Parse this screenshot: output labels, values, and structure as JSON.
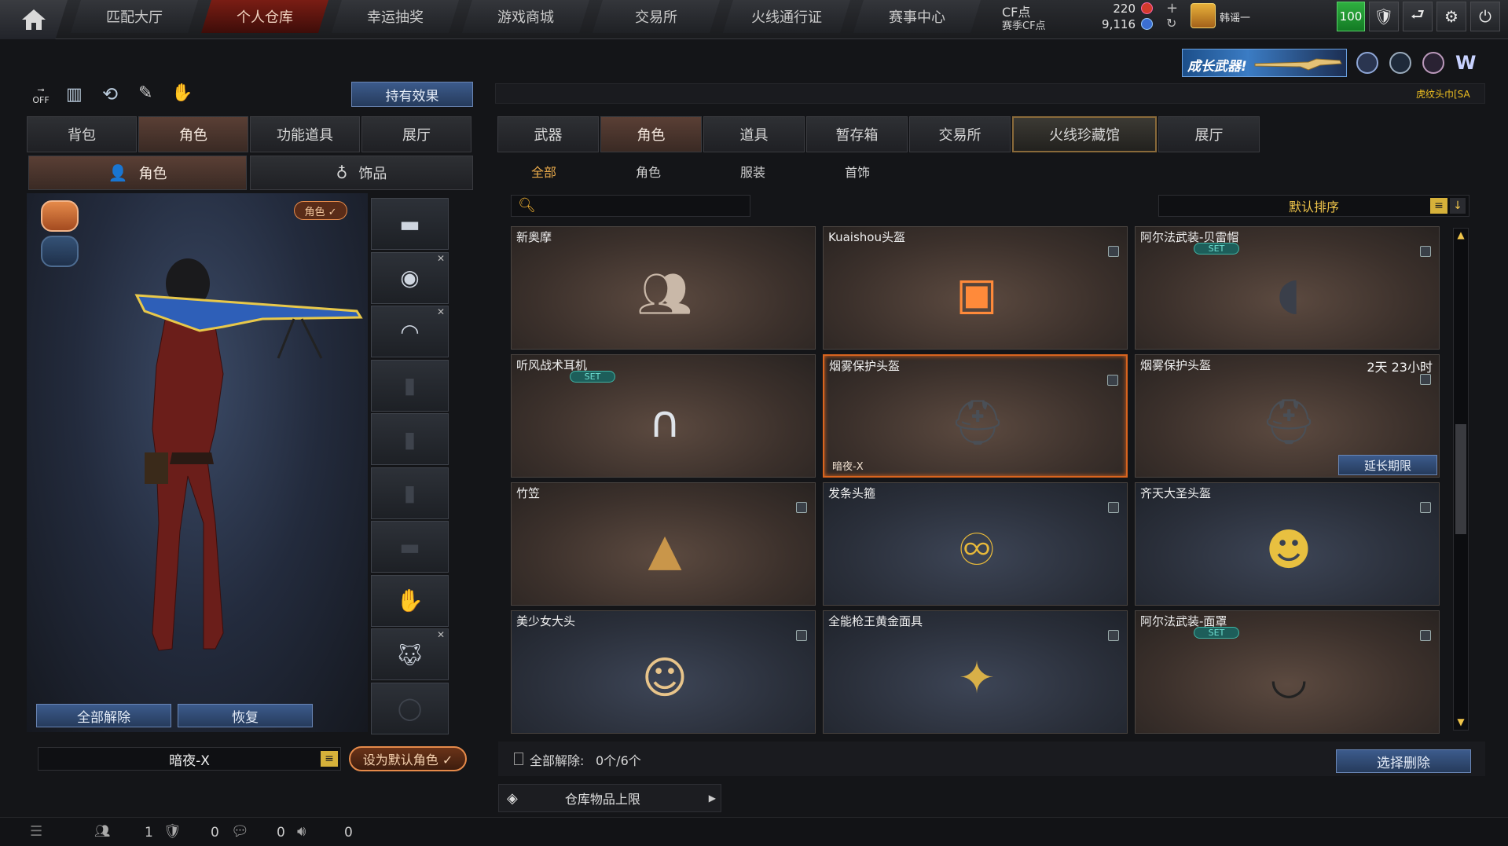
{
  "top_nav": {
    "tabs": [
      "匹配大厅",
      "个人仓库",
      "幸运抽奖",
      "游戏商城",
      "交易所",
      "火线通行证",
      "赛事中心"
    ],
    "active_index": 1,
    "cf_point_label": "CF点",
    "cf_point_value": "220",
    "season_cf_label": "赛季CF点",
    "season_cf_value": "9,116",
    "username": "韩谣一",
    "level_badge": "100"
  },
  "banner": {
    "promo_text": "成长武器!",
    "scroll_text": "虎纹头巾[SA"
  },
  "left": {
    "hold_effect_button": "持有效果",
    "main_tabs": [
      "背包",
      "角色",
      "功能道具",
      "展厅"
    ],
    "main_active": 1,
    "sub_tabs": [
      "角色",
      "饰品"
    ],
    "sub_active": 0,
    "role_badge": "角色 ✓",
    "unequip_all_button": "全部解除",
    "restore_button": "恢复",
    "character_name": "暗夜-X",
    "set_default_button": "设为默认角色 ✓"
  },
  "right": {
    "category_tabs": [
      "武器",
      "角色",
      "道具",
      "暂存箱",
      "交易所",
      "火线珍藏馆",
      "展厅"
    ],
    "category_active": 1,
    "highlight_tab": 5,
    "filter_tabs": [
      "全部",
      "角色",
      "服装",
      "首饰"
    ],
    "filter_active": 0,
    "search_placeholder": "",
    "sort_label": "默认排序",
    "items": [
      {
        "name": "新奥摩",
        "set": false,
        "tint": "brown",
        "note": ""
      },
      {
        "name": "Kuaishou头盔",
        "set": false,
        "tint": "brown",
        "note": ""
      },
      {
        "name": "阿尔法武装-贝雷帽",
        "set": true,
        "tint": "brown",
        "note": ""
      },
      {
        "name": "听风战术耳机",
        "set": true,
        "tint": "brown",
        "note": ""
      },
      {
        "name": "烟雾保护头盔",
        "set": false,
        "tint": "brown",
        "note": "暗夜-X",
        "selected": true
      },
      {
        "name": "烟雾保护头盔",
        "set": false,
        "tint": "brown",
        "note": "",
        "timer": "2天 23小时",
        "extend": "延长期限"
      },
      {
        "name": "竹笠",
        "set": false,
        "tint": "brown",
        "note": ""
      },
      {
        "name": "发条头箍",
        "set": false,
        "tint": "blue",
        "note": ""
      },
      {
        "name": "齐天大圣头盔",
        "set": false,
        "tint": "blue",
        "note": ""
      },
      {
        "name": "美少女大头",
        "set": false,
        "tint": "blue",
        "note": ""
      },
      {
        "name": "全能枪王黄金面具",
        "set": false,
        "tint": "blue",
        "note": ""
      },
      {
        "name": "阿尔法武装-面罩",
        "set": true,
        "tint": "brown",
        "note": ""
      }
    ],
    "set_label": "SET",
    "unequip_count_label": "全部解除:",
    "unequip_count_value": "0个/6个",
    "select_delete_button": "选择删除",
    "storage_limit_label": "仓库物品上限"
  },
  "status_bar": {
    "friends_count": "1",
    "clan_count": "0",
    "chat_count": "0",
    "volume_count": "0"
  }
}
